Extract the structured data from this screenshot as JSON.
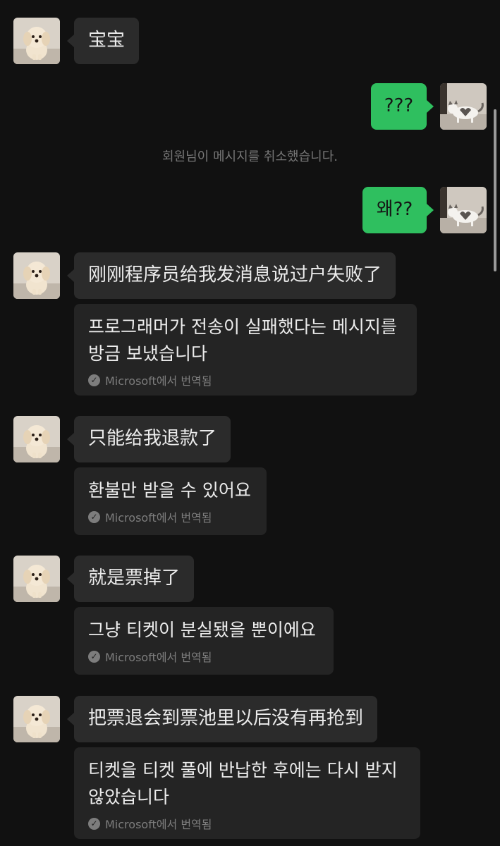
{
  "messages": {
    "m1": {
      "text": "宝宝"
    },
    "m2": {
      "text": "???"
    },
    "system_notice": "회원님이 메시지를 취소했습니다.",
    "m3": {
      "text": "왜??"
    },
    "m4": {
      "text": "刚刚程序员给我发消息说过户失败了",
      "translation": "프로그래머가 전송이 실패했다는 메시지를\n방금 보냈습니다"
    },
    "m5": {
      "text": "只能给我退款了",
      "translation": "환불만 받을 수 있어요"
    },
    "m6": {
      "text": "就是票掉了",
      "translation": "그냥 티켓이 분실됐을 뿐이에요"
    },
    "m7": {
      "text": "把票退会到票池里以后没有再抢到",
      "translation": "티켓을 티켓 풀에 반납한 후에는 다시 받지\n않았습니다"
    }
  },
  "translation_source": "Microsoft에서 번역됨",
  "icons": {
    "contact_avatar": "puppy-avatar-icon",
    "self_avatar": "cat-avatar-icon",
    "translated": "check-icon"
  },
  "colors": {
    "background": "#111111",
    "bubble_incoming": "#2b2b2b",
    "bubble_outgoing": "#2fbf5f",
    "translation_card": "#242424"
  }
}
